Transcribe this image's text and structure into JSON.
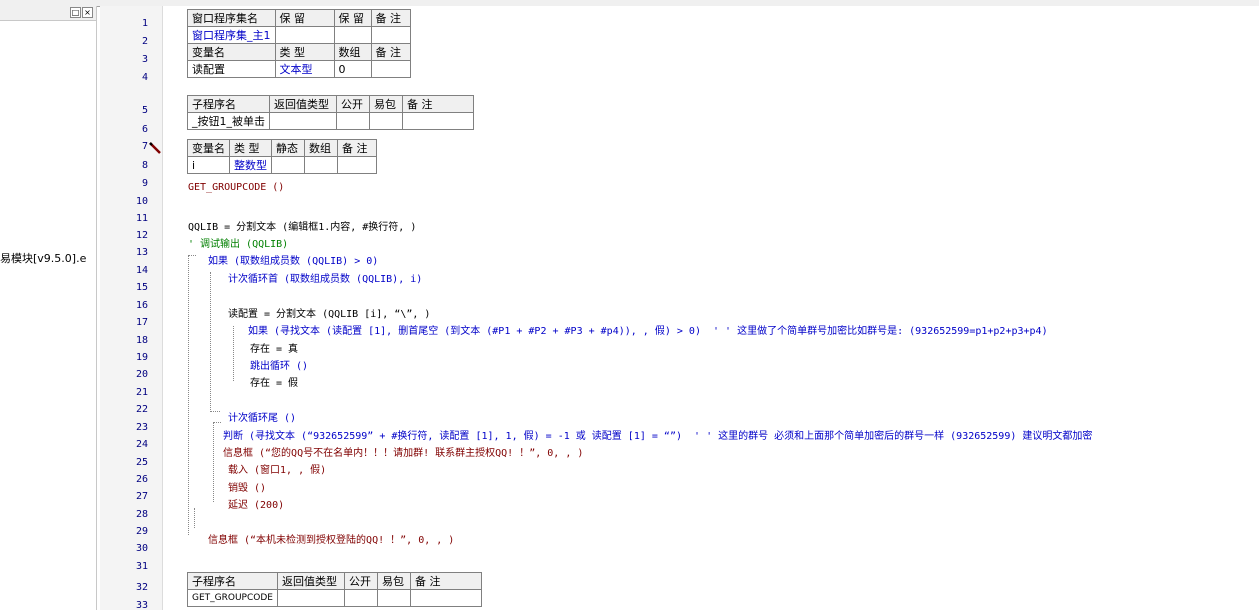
{
  "left_panel": {
    "tree_item": "易模块[v9.5.0].e",
    "btn_restore": "□",
    "btn_close": "×"
  },
  "line_numbers": [
    "1",
    "2",
    "3",
    "4",
    "5",
    "6",
    "7",
    "8",
    "9",
    "10",
    "11",
    "12",
    "13",
    "14",
    "15",
    "16",
    "17",
    "18",
    "19",
    "20",
    "21",
    "22",
    "23",
    "24",
    "25",
    "26",
    "27",
    "28",
    "29",
    "30",
    "31",
    "32",
    "33"
  ],
  "assembly_table": {
    "headers": [
      "窗口程序集名",
      "保 留",
      "保 留",
      "备 注"
    ],
    "row": [
      "窗口程序集_主1",
      "",
      "",
      ""
    ],
    "var_headers": [
      "变量名",
      "类 型",
      "数组",
      "备 注"
    ],
    "var_row": [
      "读配置",
      "文本型",
      "0",
      ""
    ]
  },
  "sub_table_1": {
    "headers": [
      "子程序名",
      "返回值类型",
      "公开",
      "易包",
      "备 注"
    ],
    "row": [
      "_按钮1_被单击",
      "",
      "",
      "",
      ""
    ]
  },
  "local_var_table": {
    "headers": [
      "变量名",
      "类 型",
      "静态",
      "数组",
      "备 注"
    ],
    "row": [
      "i",
      "整数型",
      "",
      "",
      ""
    ]
  },
  "code": {
    "l9": "GET_GROUPCODE ()",
    "l11": "QQLIB = 分割文本 (编辑框1.内容, #换行符, )",
    "l12": "' 调试输出 (QQLIB)",
    "l13": "如果 (取数组成员数 (QQLIB) > 0)",
    "l14": "计次循环首 (取数组成员数 (QQLIB), i)",
    "l16": "读配置 = 分割文本 (QQLIB [i], “\\”, )",
    "l17": "如果 (寻找文本 (读配置 [1], 删首尾空 (到文本 (#P1 + #P2 + #P3 + #p4)), , 假) > 0)  ' ' 这里做了个简单群号加密比如群号是: (932652599=p1+p2+p3+p4)",
    "l18": "存在 = 真",
    "l19": "跳出循环 ()",
    "l20": "存在 = 假",
    "l22": "计次循环尾 ()",
    "l23": "判断 (寻找文本 (“932652599” + #换行符, 读配置 [1], 1, 假) = -1 或 读配置 [1] = “”)  ' ' 这里的群号 必须和上面那个简单加密后的群号一样 (932652599) 建议明文都加密",
    "l24": "信息框 (“您的QQ号不在名单内！！！请加群! 联系群主授权QQ! ！”, 0, , )",
    "l25": "载入 (窗口1, , 假)",
    "l26": "销毁 ()",
    "l27": "延迟 (200)",
    "l29": "信息框 (“本机未检测到授权登陆的QQ! ！”, 0, , )"
  },
  "sub_table_2": {
    "headers": [
      "子程序名",
      "返回值类型",
      "公开",
      "易包",
      "备 注"
    ],
    "row": [
      "GET_GROUPCODE",
      "",
      "",
      "",
      ""
    ]
  }
}
